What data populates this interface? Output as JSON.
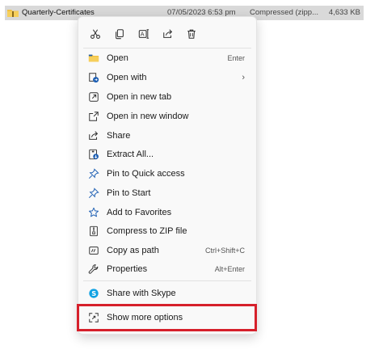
{
  "file": {
    "name": "Quarterly-Certificates",
    "date": "07/05/2023 6:53 pm",
    "type": "Compressed (zipp...",
    "size": "4,633 KB",
    "icon": "zip-folder-icon"
  },
  "quick_actions": [
    {
      "name": "cut",
      "icon": "scissors-icon"
    },
    {
      "name": "copy",
      "icon": "copy-icon"
    },
    {
      "name": "rename",
      "icon": "rename-icon"
    },
    {
      "name": "share",
      "icon": "share-icon"
    },
    {
      "name": "delete",
      "icon": "trash-icon"
    }
  ],
  "menu": {
    "items": [
      {
        "label": "Open",
        "shortcut": "Enter",
        "icon": "folder-open-icon"
      },
      {
        "label": "Open with",
        "shortcut": "",
        "icon": "open-with-icon",
        "submenu": "›"
      },
      {
        "label": "Open in new tab",
        "shortcut": "",
        "icon": "new-tab-icon"
      },
      {
        "label": "Open in new window",
        "shortcut": "",
        "icon": "new-window-icon"
      },
      {
        "label": "Share",
        "shortcut": "",
        "icon": "share-icon"
      },
      {
        "label": "Extract All...",
        "shortcut": "",
        "icon": "extract-icon"
      },
      {
        "label": "Pin to Quick access",
        "shortcut": "",
        "icon": "pin-icon"
      },
      {
        "label": "Pin to Start",
        "shortcut": "",
        "icon": "pin-icon"
      },
      {
        "label": "Add to Favorites",
        "shortcut": "",
        "icon": "star-icon"
      },
      {
        "label": "Compress to ZIP file",
        "shortcut": "",
        "icon": "zip-icon"
      },
      {
        "label": "Copy as path",
        "shortcut": "Ctrl+Shift+C",
        "icon": "copy-path-icon"
      },
      {
        "label": "Properties",
        "shortcut": "Alt+Enter",
        "icon": "wrench-icon"
      }
    ],
    "skype": {
      "label": "Share with Skype",
      "icon": "skype-icon"
    },
    "more": {
      "label": "Show more options",
      "icon": "more-options-icon"
    }
  },
  "colors": {
    "highlight_border": "#d6202b",
    "accent_blue": "#1e5fb3",
    "folder_yellow": "#f2c040",
    "skype_blue": "#10a2e3"
  }
}
